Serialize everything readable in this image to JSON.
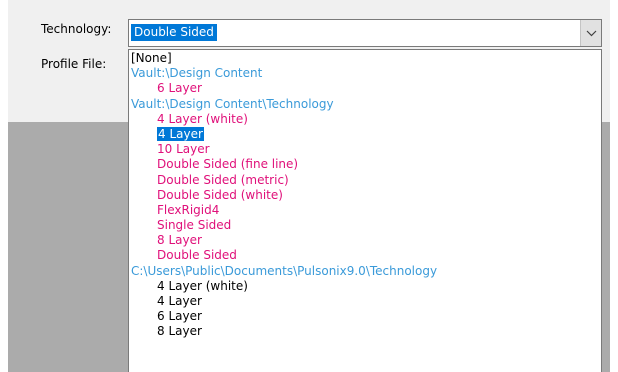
{
  "dialog": {
    "technology_label": "Technology:",
    "profile_label": "Profile File:"
  },
  "technology_combo": {
    "value": "Double Sided",
    "icon": "chevron-down-icon"
  },
  "dropdown": {
    "items": [
      {
        "text": "[None]",
        "kind": "none"
      },
      {
        "text": "Vault:\\Design Content",
        "kind": "header"
      },
      {
        "text": "6 Layer",
        "kind": "pink"
      },
      {
        "text": "Vault:\\Design Content\\Technology",
        "kind": "header"
      },
      {
        "text": "4 Layer (white)",
        "kind": "pink"
      },
      {
        "text": "4 Layer",
        "kind": "pink",
        "selected": true
      },
      {
        "text": "10 Layer",
        "kind": "pink"
      },
      {
        "text": "Double Sided (fine line)",
        "kind": "pink"
      },
      {
        "text": "Double Sided (metric)",
        "kind": "pink"
      },
      {
        "text": "Double Sided (white)",
        "kind": "pink"
      },
      {
        "text": "FlexRigid4",
        "kind": "pink"
      },
      {
        "text": "Single Sided",
        "kind": "pink"
      },
      {
        "text": "8 Layer",
        "kind": "pink"
      },
      {
        "text": "Double Sided",
        "kind": "pink"
      },
      {
        "text": "C:\\Users\\Public\\Documents\\Pulsonix9.0\\Technology",
        "kind": "header"
      },
      {
        "text": "4 Layer (white)",
        "kind": "black"
      },
      {
        "text": "4 Layer",
        "kind": "black"
      },
      {
        "text": "6 Layer",
        "kind": "black"
      },
      {
        "text": "8 Layer",
        "kind": "black"
      }
    ]
  },
  "colors": {
    "selection": "#0078d7",
    "header_text": "#3a9ad9",
    "item_text_vault": "#e0107a",
    "outside_grey": "#ababab",
    "dialog_bg": "#f0f0f0"
  }
}
